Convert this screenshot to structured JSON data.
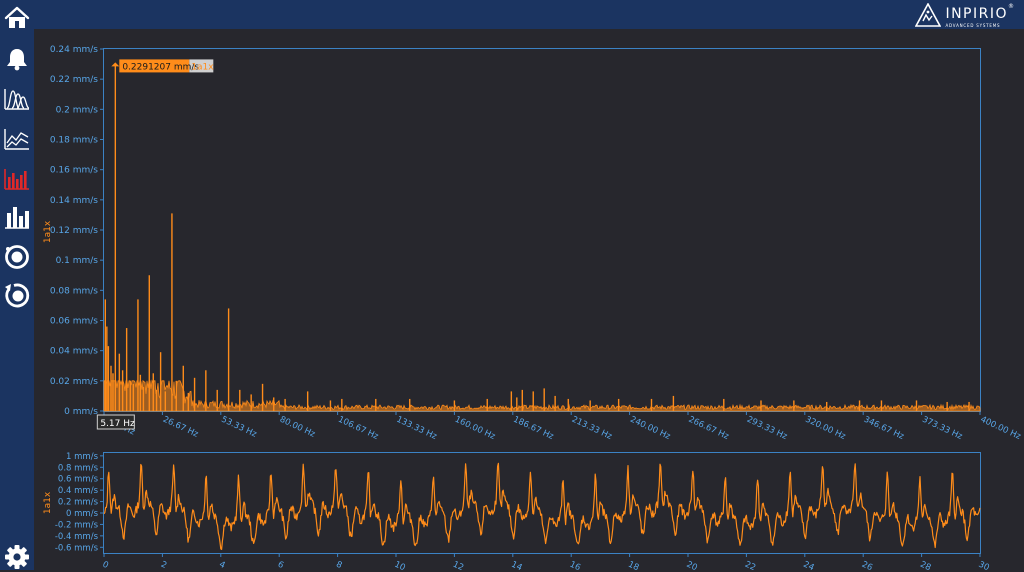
{
  "brand": {
    "name": "INPIRIO",
    "registered": "®",
    "tagline": "ADVANCED SYSTEMS"
  },
  "sidebar": {
    "items": [
      {
        "icon": "home-icon"
      },
      {
        "icon": "bell-icon"
      },
      {
        "icon": "waveform-overlay-icon"
      },
      {
        "icon": "trend-chart-icon"
      },
      {
        "icon": "spectrum-bars-icon",
        "active": true
      },
      {
        "icon": "bar-chart-icon"
      },
      {
        "icon": "orbit-icon"
      },
      {
        "icon": "orbit-rotate-icon"
      },
      {
        "icon": "gear-icon"
      }
    ]
  },
  "colors": {
    "series": "#ff8c1a",
    "axis": "#3b82c4",
    "tick_text": "#58a6e8",
    "marker_bg": "#d0d0d0",
    "background": "#27272d",
    "nav": "#1b3461"
  },
  "chart_data": [
    {
      "type": "line",
      "subtype": "spectrum",
      "ylabel": "1a1x",
      "x_ticks": [
        "0.00 Hz",
        "26.67 Hz",
        "53.33 Hz",
        "80.00 Hz",
        "106.67 Hz",
        "133.33 Hz",
        "160.00 Hz",
        "186.67 Hz",
        "213.33 Hz",
        "240.00 Hz",
        "266.67 Hz",
        "293.33 Hz",
        "320.00 Hz",
        "346.67 Hz",
        "373.33 Hz",
        "400.00 Hz"
      ],
      "y_ticks": [
        "0 mm/s",
        "0.02 mm/s",
        "0.04 mm/s",
        "0.06 mm/s",
        "0.08 mm/s",
        "0.1 mm/s",
        "0.12 mm/s",
        "0.14 mm/s",
        "0.16 mm/s",
        "0.18 mm/s",
        "0.2 mm/s",
        "0.22 mm/s",
        "0.24 mm/s"
      ],
      "xlim": [
        0,
        400
      ],
      "ylim": [
        0,
        0.24
      ],
      "peaks": [
        {
          "x": 0.6,
          "y": 0.074
        },
        {
          "x": 1.3,
          "y": 0.056
        },
        {
          "x": 2.0,
          "y": 0.043
        },
        {
          "x": 3.2,
          "y": 0.03
        },
        {
          "x": 4.1,
          "y": 0.025
        },
        {
          "x": 5.17,
          "y": 0.2291207
        },
        {
          "x": 7.0,
          "y": 0.038
        },
        {
          "x": 8.5,
          "y": 0.027
        },
        {
          "x": 10.34,
          "y": 0.055
        },
        {
          "x": 12.0,
          "y": 0.02
        },
        {
          "x": 13.4,
          "y": 0.018
        },
        {
          "x": 15.5,
          "y": 0.074
        },
        {
          "x": 16.6,
          "y": 0.024
        },
        {
          "x": 18.0,
          "y": 0.016
        },
        {
          "x": 20.68,
          "y": 0.09
        },
        {
          "x": 22.5,
          "y": 0.025
        },
        {
          "x": 24.0,
          "y": 0.014
        },
        {
          "x": 25.85,
          "y": 0.039
        },
        {
          "x": 28.0,
          "y": 0.013
        },
        {
          "x": 31.02,
          "y": 0.131
        },
        {
          "x": 33.0,
          "y": 0.02
        },
        {
          "x": 36.2,
          "y": 0.03
        },
        {
          "x": 38.5,
          "y": 0.012
        },
        {
          "x": 41.36,
          "y": 0.022
        },
        {
          "x": 46.5,
          "y": 0.027
        },
        {
          "x": 51.7,
          "y": 0.014
        },
        {
          "x": 56.9,
          "y": 0.068
        },
        {
          "x": 62.0,
          "y": 0.014
        },
        {
          "x": 67.2,
          "y": 0.011
        },
        {
          "x": 72.4,
          "y": 0.018
        },
        {
          "x": 77.5,
          "y": 0.009
        },
        {
          "x": 82.7,
          "y": 0.008
        },
        {
          "x": 93.0,
          "y": 0.013
        },
        {
          "x": 103.4,
          "y": 0.007
        },
        {
          "x": 108.6,
          "y": 0.008
        },
        {
          "x": 124.1,
          "y": 0.008
        },
        {
          "x": 139.6,
          "y": 0.008
        },
        {
          "x": 160.0,
          "y": 0.007
        },
        {
          "x": 175.0,
          "y": 0.008
        },
        {
          "x": 186.0,
          "y": 0.013
        },
        {
          "x": 188.5,
          "y": 0.009
        },
        {
          "x": 191.0,
          "y": 0.014
        },
        {
          "x": 196.0,
          "y": 0.013
        },
        {
          "x": 201.0,
          "y": 0.015
        },
        {
          "x": 206.0,
          "y": 0.01
        },
        {
          "x": 212.0,
          "y": 0.008
        },
        {
          "x": 222.0,
          "y": 0.007
        },
        {
          "x": 235.0,
          "y": 0.008
        },
        {
          "x": 250.0,
          "y": 0.008
        },
        {
          "x": 260.0,
          "y": 0.01
        },
        {
          "x": 283.0,
          "y": 0.008
        },
        {
          "x": 300.0,
          "y": 0.007
        },
        {
          "x": 315.0,
          "y": 0.007
        },
        {
          "x": 330.0,
          "y": 0.006
        },
        {
          "x": 345.0,
          "y": 0.007
        },
        {
          "x": 355.0,
          "y": 0.007
        },
        {
          "x": 371.0,
          "y": 0.007
        },
        {
          "x": 385.0,
          "y": 0.006
        },
        {
          "x": 395.0,
          "y": 0.006
        }
      ],
      "noise_floor": 0.002,
      "marker": {
        "x": 5.17,
        "y": 0.2291207,
        "value_label": "0.2291207 mm/s",
        "series_label": "1a1x",
        "x_label": "5.17 Hz"
      }
    },
    {
      "type": "line",
      "subtype": "waveform",
      "ylabel": "1a1x",
      "x_ticks": [
        "0",
        "2",
        "4",
        "6",
        "8",
        "10",
        "12",
        "14",
        "16",
        "18",
        "20",
        "22",
        "24",
        "26",
        "28",
        "30"
      ],
      "y_ticks": [
        "-0.6 mm/s",
        "-0.4 mm/s",
        "-0.2 mm/s",
        "0 mm/s",
        "0.2 mm/s",
        "0.4 mm/s",
        "0.6 mm/s",
        "0.8 mm/s",
        "1 mm/s"
      ],
      "xlim": [
        0,
        30
      ],
      "ylim": [
        -0.7,
        1.05
      ],
      "fundamental_hz": 0.9,
      "amplitudes": {
        "pulse_peak": 0.75,
        "baseline": -0.05,
        "trough": -0.35,
        "noise": 0.08
      }
    }
  ]
}
